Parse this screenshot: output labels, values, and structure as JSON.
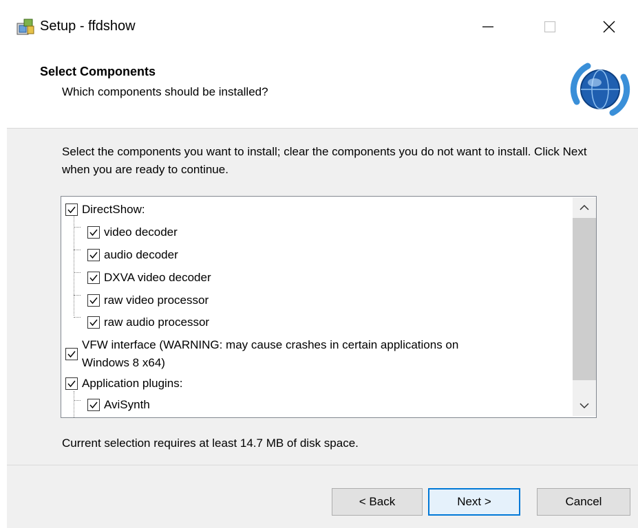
{
  "window": {
    "title": "Setup - ffdshow"
  },
  "header": {
    "title": "Select Components",
    "subtitle": "Which components should be installed?"
  },
  "instructions": "Select the components you want to install; clear the components you do not want to install. Click Next when you are ready to continue.",
  "components": [
    {
      "label": "DirectShow:",
      "checked": true,
      "level": 0
    },
    {
      "label": "video decoder",
      "checked": true,
      "level": 1
    },
    {
      "label": "audio decoder",
      "checked": true,
      "level": 1
    },
    {
      "label": "DXVA video decoder",
      "checked": true,
      "level": 1
    },
    {
      "label": "raw video processor",
      "checked": true,
      "level": 1
    },
    {
      "label": "raw audio processor",
      "checked": true,
      "level": 1
    },
    {
      "label_line1": "VFW interface (WARNING: may cause crashes in certain applications on",
      "label_line2": "Windows 8 x64)",
      "checked": true,
      "level": 0
    },
    {
      "label": "Application plugins:",
      "checked": true,
      "level": 0
    },
    {
      "label": "AviSynth",
      "checked": true,
      "level": 1
    }
  ],
  "disk_space": "Current selection requires at least 14.7 MB of disk space.",
  "buttons": {
    "back": "< Back",
    "next": "Next >",
    "cancel": "Cancel"
  },
  "colors": {
    "accent": "#0078d7",
    "dialog_bg": "#f0f0f0"
  }
}
